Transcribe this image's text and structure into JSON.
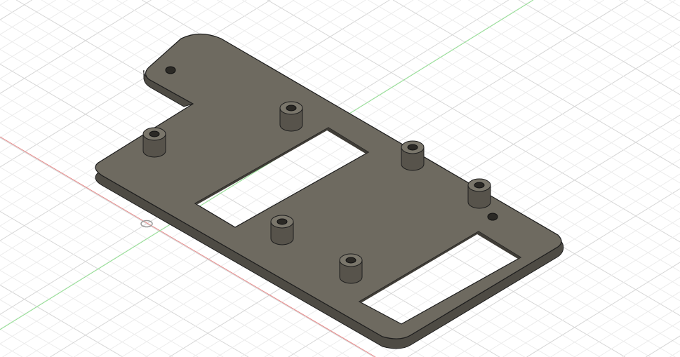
{
  "viewport": {
    "colors": {
      "background": "#ffffff",
      "grid_minor": "#ececec",
      "grid_major": "#d6d6d6",
      "x_axis": "#e88a8a",
      "y_axis": "#8fe08f",
      "plate_top": "#6e6a60",
      "plate_side": "#4e4b44",
      "edge": "#1e1e1e"
    },
    "standoff_count": 6,
    "cutout_count": 2,
    "small_hole_count": 2
  }
}
